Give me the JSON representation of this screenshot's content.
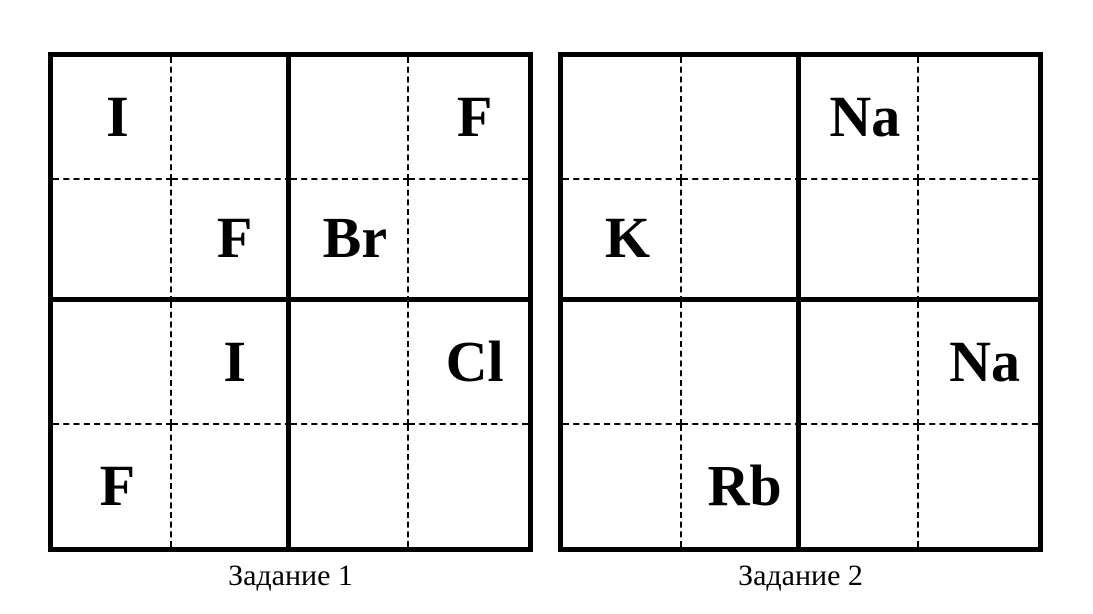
{
  "page": {
    "background": "#ffffff",
    "ink": "#000000"
  },
  "puzzles": [
    {
      "id": "task-1",
      "caption": "Задание 1",
      "size": 4,
      "rows": [
        [
          "I",
          "",
          "",
          "F"
        ],
        [
          "",
          "F",
          "Br",
          ""
        ],
        [
          "",
          "I",
          "",
          "Cl"
        ],
        [
          "F",
          "",
          "",
          ""
        ]
      ]
    },
    {
      "id": "task-2",
      "caption": "Задание 2",
      "size": 4,
      "rows": [
        [
          "",
          "",
          "Na",
          ""
        ],
        [
          "K",
          "",
          "",
          ""
        ],
        [
          "",
          "",
          "",
          "Na"
        ],
        [
          "",
          "Rb",
          "",
          ""
        ]
      ]
    }
  ]
}
